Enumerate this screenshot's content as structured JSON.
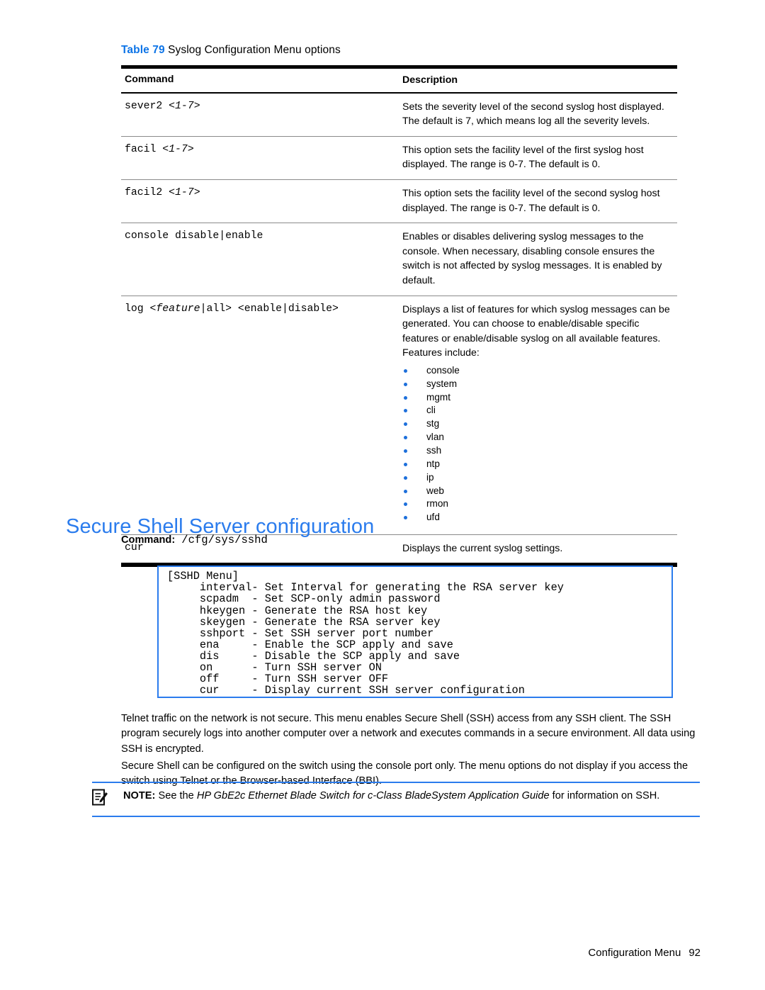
{
  "table": {
    "caption_label": "Table 79",
    "caption_title": "Syslog Configuration Menu options",
    "headers": {
      "command": "Command",
      "description": "Description"
    },
    "rows": [
      {
        "command_plain": "sever2 <1-7>",
        "command_pre": "sever2 <",
        "command_em": "1-7",
        "command_post": ">",
        "description": "Sets the severity level of the second syslog host displayed. The default is 7, which means log all the severity levels."
      },
      {
        "command_plain": "facil <1-7>",
        "command_pre": "facil <",
        "command_em": "1-7",
        "command_post": ">",
        "description": "This option sets the facility level of the first syslog host displayed. The range is 0-7. The default is 0."
      },
      {
        "command_plain": "facil2 <1-7>",
        "command_pre": "facil2 <",
        "command_em": "1-7",
        "command_post": ">",
        "description": "This option sets the facility level of the second syslog host displayed. The range is 0-7. The default is 0."
      },
      {
        "command_plain": "console disable|enable",
        "command_pre": "console disable|enable",
        "command_em": "",
        "command_post": "",
        "description": "Enables or disables delivering syslog messages to the console. When necessary, disabling console ensures the switch is not affected by syslog messages. It is enabled by default."
      },
      {
        "command_plain": "log <feature|all> <enable|disable>",
        "command_pre": "log <",
        "command_em": "feature",
        "command_post": "|all> <enable|disable>",
        "description": "Displays a list of features for which syslog messages can be generated. You can choose to enable/disable specific features or enable/disable syslog on all available features. Features include:",
        "features": [
          "console",
          "system",
          "mgmt",
          "cli",
          "stg",
          "vlan",
          "ssh",
          "ntp",
          "ip",
          "web",
          "rmon",
          "ufd"
        ]
      },
      {
        "command_plain": "cur",
        "command_pre": "cur",
        "command_em": "",
        "command_post": "",
        "description": "Displays the current syslog settings."
      }
    ]
  },
  "section": {
    "heading": "Secure Shell Server configuration",
    "command_label": "Command:",
    "command_path": "/cfg/sys/sshd"
  },
  "code_block": {
    "text": "[SSHD Menu]\n     interval- Set Interval for generating the RSA server key\n     scpadm  - Set SCP-only admin password\n     hkeygen - Generate the RSA host key\n     skeygen - Generate the RSA server key\n     sshport - Set SSH server port number\n     ena     - Enable the SCP apply and save\n     dis     - Disable the SCP apply and save\n     on      - Turn SSH server ON\n     off     - Turn SSH server OFF\n     cur     - Display current SSH server configuration"
  },
  "paragraphs": {
    "p1": "Telnet traffic on the network is not secure. This menu enables Secure Shell (SSH) access from any SSH client. The SSH program securely logs into another computer over a network and executes commands in a secure environment. All data using SSH is encrypted.",
    "p2": "Secure Shell can be configured on the switch using the console port only. The menu options do not display if you access the switch using Telnet or the Browser-based Interface (BBI)."
  },
  "note": {
    "label": "NOTE:",
    "text_before": "See the ",
    "text_italic": "HP GbE2c Ethernet Blade Switch for c-Class BladeSystem Application Guide",
    "text_after": " for information on SSH."
  },
  "footer": {
    "label": "Configuration Menu",
    "page_number": "92"
  },
  "colors": {
    "accent_blue": "#2b7ced",
    "caption_blue": "#0d74e7",
    "bullet_blue": "#1d6fdb"
  }
}
